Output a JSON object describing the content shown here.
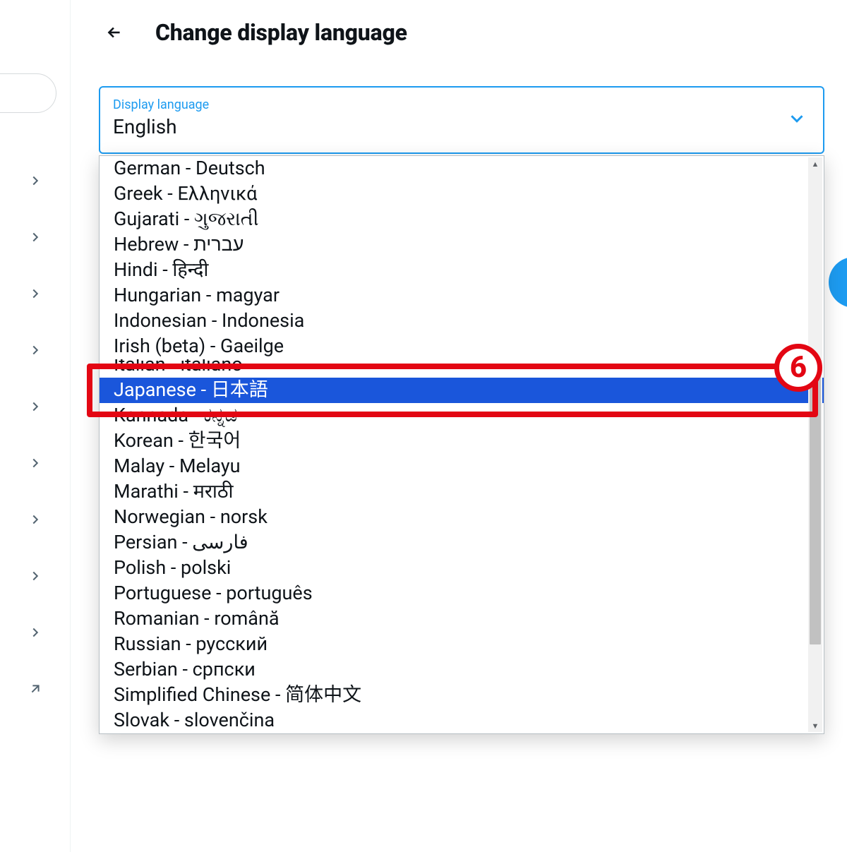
{
  "header": {
    "title": "Change display language",
    "back_icon": "arrow-left"
  },
  "select": {
    "label": "Display language",
    "value": "English"
  },
  "options": [
    {
      "label": "German - Deutsch",
      "selected": false
    },
    {
      "label": "Greek - Ελληνικά",
      "selected": false
    },
    {
      "label": "Gujarati - ગુજરાતી",
      "selected": false
    },
    {
      "label": "Hebrew - עברית",
      "selected": false
    },
    {
      "label": "Hindi - हिन्दी",
      "selected": false
    },
    {
      "label": "Hungarian - magyar",
      "selected": false
    },
    {
      "label": "Indonesian - Indonesia",
      "selected": false
    },
    {
      "label": "Irish (beta) - Gaeilge",
      "selected": false
    },
    {
      "label": "Italian - italiano",
      "selected": false,
      "clipped": true
    },
    {
      "label": "Japanese - 日本語",
      "selected": true
    },
    {
      "label": "Kannada - ಕನ್ನಡ",
      "selected": false
    },
    {
      "label": "Korean - 한국어",
      "selected": false
    },
    {
      "label": "Malay - Melayu",
      "selected": false
    },
    {
      "label": "Marathi - मराठी",
      "selected": false
    },
    {
      "label": "Norwegian - norsk",
      "selected": false
    },
    {
      "label": "Persian - فارسی",
      "selected": false
    },
    {
      "label": "Polish - polski",
      "selected": false
    },
    {
      "label": "Portuguese - português",
      "selected": false
    },
    {
      "label": "Romanian - română",
      "selected": false
    },
    {
      "label": "Russian - русский",
      "selected": false
    },
    {
      "label": "Serbian - српски",
      "selected": false
    },
    {
      "label": "Simplified Chinese - 简体中文",
      "selected": false
    },
    {
      "label": "Slovak - slovenčina",
      "selected": false
    }
  ],
  "sidebar": {
    "chevron_count": 9,
    "external_link_icon": "arrow-up-right"
  },
  "annotation": {
    "number": "6",
    "target_option_index": 9
  },
  "colors": {
    "accent": "#1d9bf0",
    "highlight_bg": "#1a56db",
    "annotation": "#e30613"
  }
}
